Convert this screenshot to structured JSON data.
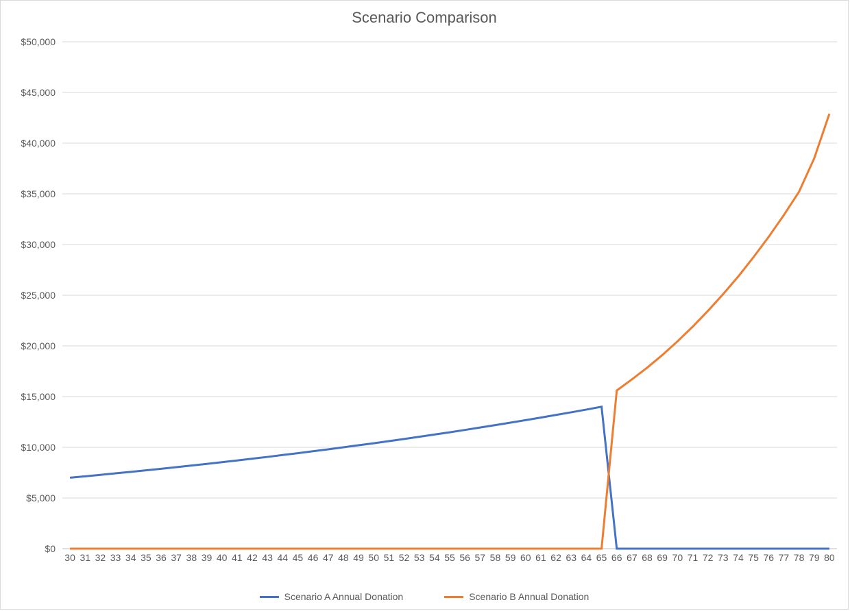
{
  "chart_data": {
    "type": "line",
    "title": "Scenario Comparison",
    "xlabel": "",
    "ylabel": "",
    "ylim": [
      0,
      50000
    ],
    "y_ticks": [
      0,
      5000,
      10000,
      15000,
      20000,
      25000,
      30000,
      35000,
      40000,
      45000,
      50000
    ],
    "y_tick_labels": [
      "$0",
      "$5,000",
      "$10,000",
      "$15,000",
      "$20,000",
      "$25,000",
      "$30,000",
      "$35,000",
      "$40,000",
      "$45,000",
      "$50,000"
    ],
    "categories": [
      30,
      31,
      32,
      33,
      34,
      35,
      36,
      37,
      38,
      39,
      40,
      41,
      42,
      43,
      44,
      45,
      46,
      47,
      48,
      49,
      50,
      51,
      52,
      53,
      54,
      55,
      56,
      57,
      58,
      59,
      60,
      61,
      62,
      63,
      64,
      65,
      66,
      67,
      68,
      69,
      70,
      71,
      72,
      73,
      74,
      75,
      76,
      77,
      78,
      79,
      80
    ],
    "series": [
      {
        "name": "Scenario A Annual Donation",
        "color": "#4472C4",
        "values": [
          7000,
          7140,
          7280,
          7430,
          7580,
          7730,
          7880,
          8040,
          8200,
          8360,
          8530,
          8700,
          8880,
          9050,
          9240,
          9420,
          9610,
          9800,
          10000,
          10200,
          10400,
          10610,
          10820,
          11040,
          11260,
          11480,
          11710,
          11950,
          12190,
          12430,
          12680,
          12930,
          13190,
          13450,
          13720,
          14000,
          0,
          0,
          0,
          0,
          0,
          0,
          0,
          0,
          0,
          0,
          0,
          0,
          0,
          0,
          0
        ]
      },
      {
        "name": "Scenario B Annual Donation",
        "color": "#ED7D31",
        "values": [
          0,
          0,
          0,
          0,
          0,
          0,
          0,
          0,
          0,
          0,
          0,
          0,
          0,
          0,
          0,
          0,
          0,
          0,
          0,
          0,
          0,
          0,
          0,
          0,
          0,
          0,
          0,
          0,
          0,
          0,
          0,
          0,
          0,
          0,
          0,
          0,
          15600,
          16700,
          17850,
          19100,
          20450,
          21900,
          23450,
          25100,
          26850,
          28750,
          30750,
          32900,
          35200,
          38500,
          42900
        ]
      }
    ],
    "legend_position": "bottom"
  }
}
